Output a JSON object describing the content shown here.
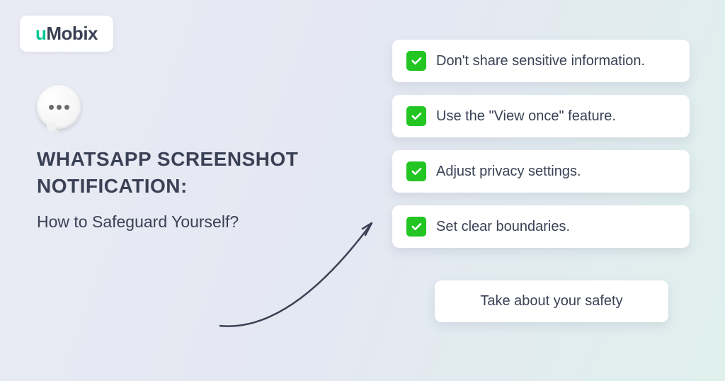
{
  "logo": {
    "prefix": "u",
    "suffix": "Mobix"
  },
  "title": {
    "main": "WHATSAPP SCREENSHOT NOTIFICATION:",
    "sub": "How to Safeguard Yourself?"
  },
  "tips": [
    "Don't share sensitive information.",
    "Use the \"View once\" feature.",
    "Adjust privacy settings.",
    "Set clear boundaries."
  ],
  "cta": "Take about your safety"
}
